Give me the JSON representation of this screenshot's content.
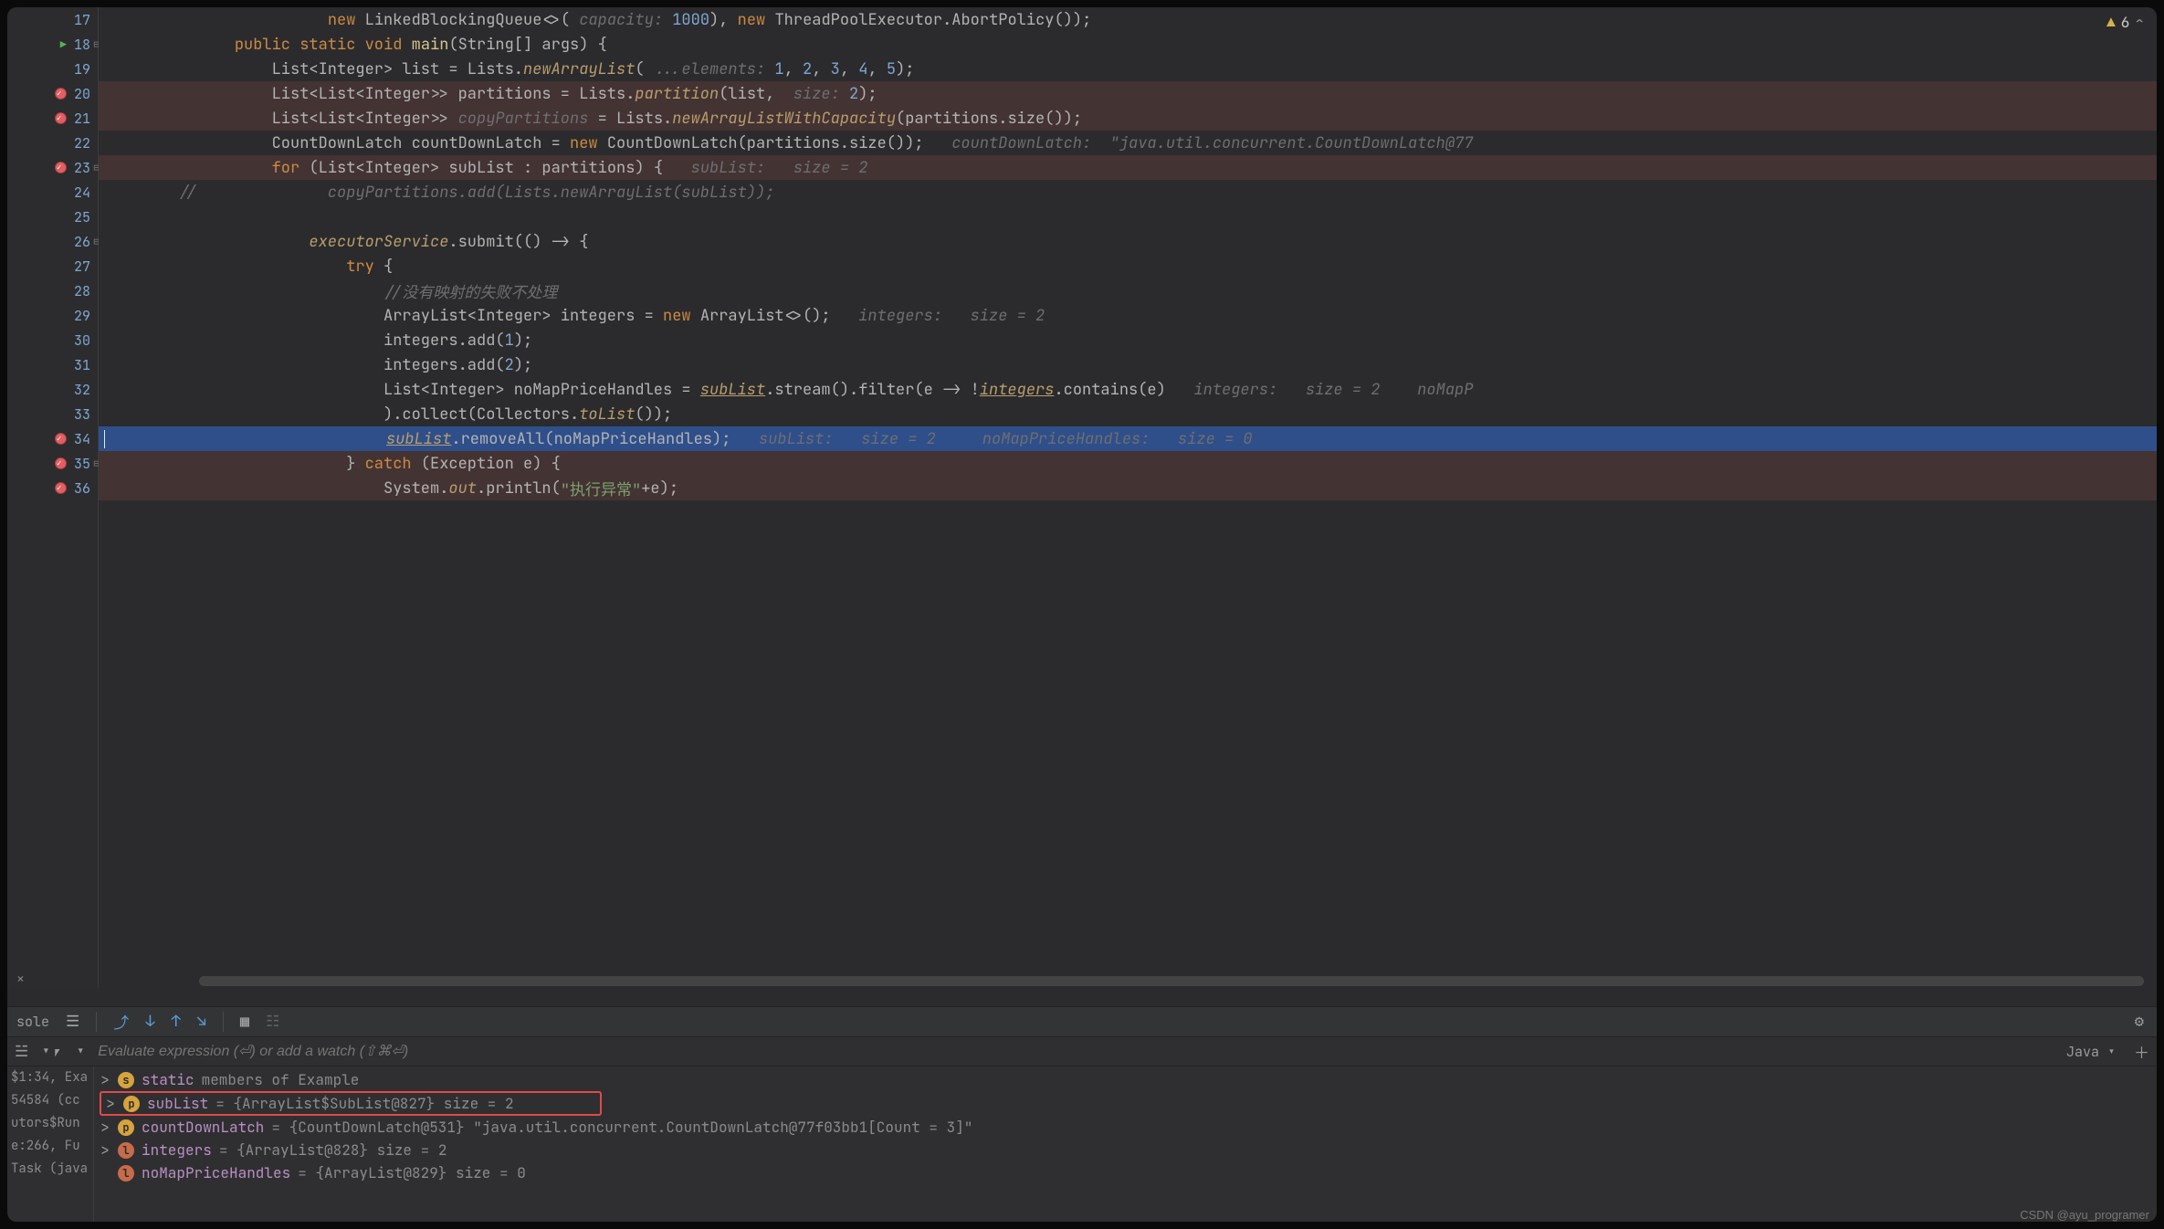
{
  "warnings": {
    "count": "6"
  },
  "editor": {
    "lines": [
      {
        "n": "17",
        "bp": false,
        "run": false,
        "fold": "",
        "cls": "",
        "tokens": [
          {
            "t": "                        ",
            "c": ""
          },
          {
            "t": "new ",
            "c": "kw"
          },
          {
            "t": "LinkedBlockingQueue<>( ",
            "c": "ident"
          },
          {
            "t": "capacity: ",
            "c": "hint"
          },
          {
            "t": "1000",
            "c": "num"
          },
          {
            "t": "), ",
            "c": "ident"
          },
          {
            "t": "new ",
            "c": "kw"
          },
          {
            "t": "ThreadPoolExecutor.AbortPolicy());",
            "c": "ident"
          }
        ]
      },
      {
        "n": "18",
        "bp": false,
        "run": true,
        "fold": "⊟",
        "cls": "",
        "tokens": [
          {
            "t": "              ",
            "c": ""
          },
          {
            "t": "public static void ",
            "c": "kw"
          },
          {
            "t": "main",
            "c": "call"
          },
          {
            "t": "(String[] args) {",
            "c": "ident"
          }
        ]
      },
      {
        "n": "19",
        "bp": false,
        "run": false,
        "fold": "",
        "cls": "",
        "tokens": [
          {
            "t": "                  List<Integer> list = Lists.",
            "c": "ident"
          },
          {
            "t": "newArrayList",
            "c": "ital"
          },
          {
            "t": "( ",
            "c": "ident"
          },
          {
            "t": "...elements: ",
            "c": "hint"
          },
          {
            "t": "1",
            "c": "num"
          },
          {
            "t": ", ",
            "c": "ident"
          },
          {
            "t": "2",
            "c": "num"
          },
          {
            "t": ", ",
            "c": "ident"
          },
          {
            "t": "3",
            "c": "num"
          },
          {
            "t": ", ",
            "c": "ident"
          },
          {
            "t": "4",
            "c": "num"
          },
          {
            "t": ", ",
            "c": "ident"
          },
          {
            "t": "5",
            "c": "num"
          },
          {
            "t": ");",
            "c": "ident"
          }
        ]
      },
      {
        "n": "20",
        "bp": true,
        "run": false,
        "fold": "",
        "cls": "bp-bg",
        "tokens": [
          {
            "t": "                  List<List<Integer>> partitions = Lists.",
            "c": "ident"
          },
          {
            "t": "partition",
            "c": "ital"
          },
          {
            "t": "(list,  ",
            "c": "ident"
          },
          {
            "t": "size: ",
            "c": "hint"
          },
          {
            "t": "2",
            "c": "num"
          },
          {
            "t": ");",
            "c": "ident"
          }
        ]
      },
      {
        "n": "21",
        "bp": true,
        "run": false,
        "fold": "",
        "cls": "bp-bg",
        "tokens": [
          {
            "t": "                  List<List<Integer>> ",
            "c": "ident"
          },
          {
            "t": "copyPartitions",
            "c": "hint"
          },
          {
            "t": " = Lists.",
            "c": "ident"
          },
          {
            "t": "newArrayListWithCapacity",
            "c": "ital"
          },
          {
            "t": "(partitions.size());",
            "c": "ident"
          }
        ]
      },
      {
        "n": "22",
        "bp": false,
        "run": false,
        "fold": "",
        "cls": "",
        "tokens": [
          {
            "t": "                  CountDownLatch countDownLatch = ",
            "c": "ident"
          },
          {
            "t": "new ",
            "c": "kw"
          },
          {
            "t": "CountDownLatch(partitions.size());   ",
            "c": "ident"
          },
          {
            "t": "countDownLatch:  \"java.util.concurrent.CountDownLatch@77",
            "c": "hint"
          }
        ]
      },
      {
        "n": "23",
        "bp": true,
        "run": false,
        "fold": "⊟",
        "cls": "bp-bg",
        "tokens": [
          {
            "t": "                  ",
            "c": ""
          },
          {
            "t": "for ",
            "c": "kw"
          },
          {
            "t": "(List<Integer> subList : partitions) {   ",
            "c": "ident"
          },
          {
            "t": "subList:   size = 2",
            "c": "hint"
          }
        ]
      },
      {
        "n": "24",
        "bp": false,
        "run": false,
        "fold": "",
        "cls": "",
        "tokens": [
          {
            "t": "        ",
            "c": ""
          },
          {
            "t": "//              copyPartitions.add(Lists.newArrayList(subList));",
            "c": "comment"
          }
        ]
      },
      {
        "n": "25",
        "bp": false,
        "run": false,
        "fold": "",
        "cls": "",
        "tokens": [
          {
            "t": "",
            "c": ""
          }
        ]
      },
      {
        "n": "26",
        "bp": false,
        "run": false,
        "fold": "⊟",
        "cls": "",
        "tokens": [
          {
            "t": "                      ",
            "c": ""
          },
          {
            "t": "executorService",
            "c": "ital"
          },
          {
            "t": ".submit(() -> {",
            "c": "ident"
          }
        ]
      },
      {
        "n": "27",
        "bp": false,
        "run": false,
        "fold": "",
        "cls": "",
        "tokens": [
          {
            "t": "                          ",
            "c": ""
          },
          {
            "t": "try ",
            "c": "kw"
          },
          {
            "t": "{",
            "c": "ident"
          }
        ]
      },
      {
        "n": "28",
        "bp": false,
        "run": false,
        "fold": "",
        "cls": "",
        "tokens": [
          {
            "t": "                              ",
            "c": ""
          },
          {
            "t": "//没有映射的失败不处理",
            "c": "comment"
          }
        ]
      },
      {
        "n": "29",
        "bp": false,
        "run": false,
        "fold": "",
        "cls": "",
        "tokens": [
          {
            "t": "                              ArrayList<Integer> integers = ",
            "c": "ident"
          },
          {
            "t": "new ",
            "c": "kw"
          },
          {
            "t": "ArrayList<>();   ",
            "c": "ident"
          },
          {
            "t": "integers:   size = 2",
            "c": "hint"
          }
        ]
      },
      {
        "n": "30",
        "bp": false,
        "run": false,
        "fold": "",
        "cls": "",
        "tokens": [
          {
            "t": "                              integers.add(",
            "c": "ident"
          },
          {
            "t": "1",
            "c": "num"
          },
          {
            "t": ");",
            "c": "ident"
          }
        ]
      },
      {
        "n": "31",
        "bp": false,
        "run": false,
        "fold": "",
        "cls": "",
        "tokens": [
          {
            "t": "                              integers.add(",
            "c": "ident"
          },
          {
            "t": "2",
            "c": "num"
          },
          {
            "t": ");",
            "c": "ident"
          }
        ]
      },
      {
        "n": "32",
        "bp": false,
        "run": false,
        "fold": "",
        "cls": "",
        "tokens": [
          {
            "t": "                              List<Integer> noMapPriceHandles = ",
            "c": "ident"
          },
          {
            "t": "subList",
            "c": "ital under"
          },
          {
            "t": ".stream().filter(e -> !",
            "c": "ident"
          },
          {
            "t": "integers",
            "c": "ital under"
          },
          {
            "t": ".contains(e)   ",
            "c": "ident"
          },
          {
            "t": "integers:   size = 2    noMapP",
            "c": "hint"
          }
        ]
      },
      {
        "n": "33",
        "bp": false,
        "run": false,
        "fold": "",
        "cls": "",
        "tokens": [
          {
            "t": "                              ).collect(Collectors.",
            "c": "ident"
          },
          {
            "t": "toList",
            "c": "ital"
          },
          {
            "t": "());",
            "c": "ident"
          }
        ]
      },
      {
        "n": "34",
        "bp": true,
        "run": false,
        "fold": "",
        "cls": "hl",
        "caret": true,
        "tokens": [
          {
            "t": "                              ",
            "c": ""
          },
          {
            "t": "subList",
            "c": "ital under"
          },
          {
            "t": ".removeAll(noMapPriceHandles);   ",
            "c": "ident"
          },
          {
            "t": "subList:   size = 2     noMapPriceHandles:   size = 0",
            "c": "hint"
          }
        ]
      },
      {
        "n": "35",
        "bp": true,
        "run": false,
        "fold": "⊟",
        "cls": "bp-bg",
        "tokens": [
          {
            "t": "                          } ",
            "c": "ident"
          },
          {
            "t": "catch ",
            "c": "kw"
          },
          {
            "t": "(Exception e) {",
            "c": "ident"
          }
        ]
      },
      {
        "n": "36",
        "bp": true,
        "run": false,
        "fold": "",
        "cls": "bp-bg",
        "tokens": [
          {
            "t": "                              System.",
            "c": "ident"
          },
          {
            "t": "out",
            "c": "ital"
          },
          {
            "t": ".println(",
            "c": "ident"
          },
          {
            "t": "\"执行异常\"",
            "c": "str"
          },
          {
            "t": "+e);",
            "c": "ident"
          }
        ]
      }
    ]
  },
  "midbar": {
    "label": "sole"
  },
  "evalbar": {
    "placeholder": "Evaluate expression (⏎) or add a watch (⇧⌘⏎)",
    "lang": "Java"
  },
  "frames": [
    "$1:34, Exa",
    "54584 (cc",
    "utors$Run",
    "e:266, Fu",
    "Task (java"
  ],
  "variables": [
    {
      "exp": ">",
      "badge": "s",
      "name": "static",
      "rest": " members of Example",
      "boxed": false
    },
    {
      "exp": ">",
      "badge": "p",
      "name": "subList",
      "rest": " = {ArrayList$SubList@827}  size = 2",
      "boxed": true
    },
    {
      "exp": ">",
      "badge": "p",
      "name": "countDownLatch",
      "rest": " = {CountDownLatch@531} \"java.util.concurrent.CountDownLatch@77f03bb1[Count = 3]\"",
      "boxed": false
    },
    {
      "exp": ">",
      "badge": "l",
      "name": "integers",
      "rest": " = {ArrayList@828}  size = 2",
      "boxed": false
    },
    {
      "exp": "",
      "badge": "l",
      "name": "noMapPriceHandles",
      "rest": " = {ArrayList@829}  size = 0",
      "boxed": false
    }
  ],
  "watermark": "CSDN @ayu_programer"
}
